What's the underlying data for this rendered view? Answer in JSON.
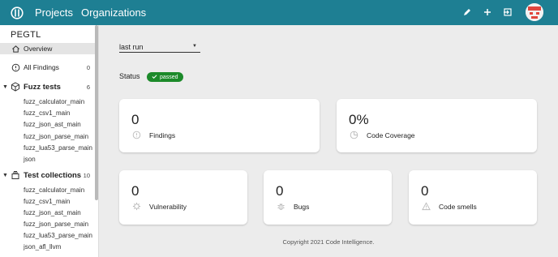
{
  "header": {
    "nav": [
      "Projects",
      "Organizations"
    ],
    "actions": [
      {
        "icon": "pencil-icon"
      },
      {
        "icon": "plus-icon"
      },
      {
        "icon": "exit-icon"
      }
    ],
    "bar_color": "#1e7f93"
  },
  "sidebar": {
    "project": "PEGTL",
    "overview": "Overview",
    "all_findings": {
      "label": "All Findings",
      "count": "0"
    },
    "fuzz_tests": {
      "label": "Fuzz tests",
      "count": "6",
      "items": [
        "fuzz_calculator_main",
        "fuzz_csv1_main",
        "fuzz_json_ast_main",
        "fuzz_json_parse_main",
        "fuzz_lua53_parse_main",
        "json"
      ]
    },
    "test_collections": {
      "label": "Test collections",
      "count": "10",
      "items": [
        "fuzz_calculator_main",
        "fuzz_csv1_main",
        "fuzz_json_ast_main",
        "fuzz_json_parse_main",
        "fuzz_lua53_parse_main",
        "json_afl_llvm"
      ]
    }
  },
  "main": {
    "run_select": "last run",
    "status_label": "Status",
    "status_badge": "passed",
    "status_color": "#1c8a2a",
    "cards": {
      "findings": {
        "value": "0",
        "label": "Findings"
      },
      "coverage": {
        "value": "0%",
        "label": "Code Coverage"
      },
      "vulnerability": {
        "value": "0",
        "label": "Vulnerability"
      },
      "bugs": {
        "value": "0",
        "label": "Bugs"
      },
      "smells": {
        "value": "0",
        "label": "Code smells"
      }
    },
    "copyright": "Copyright 2021 Code Intelligence."
  }
}
